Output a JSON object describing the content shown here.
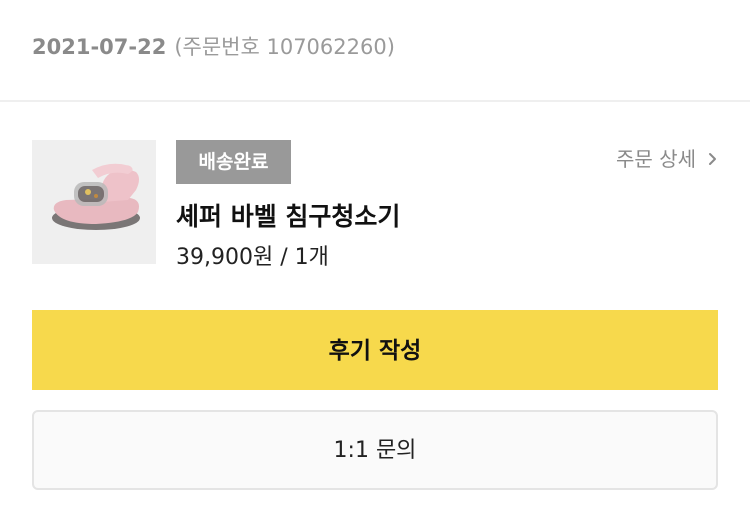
{
  "order": {
    "date": "2021-07-22",
    "number_text": "(주문번호 107062260)"
  },
  "product": {
    "status_badge": "배송완료",
    "detail_link_label": "주문 상세",
    "name": "셰퍼 바벨 침구청소기",
    "price_quantity": "39,900원 / 1개",
    "thumbnail_icon": "bed-vacuum-cleaner-product-image"
  },
  "actions": {
    "review_label": "후기 작성",
    "inquiry_label": "1:1 문의"
  },
  "colors": {
    "accent_yellow": "#f7d94c",
    "badge_gray": "#999999",
    "muted_text": "#8e8e8e"
  }
}
